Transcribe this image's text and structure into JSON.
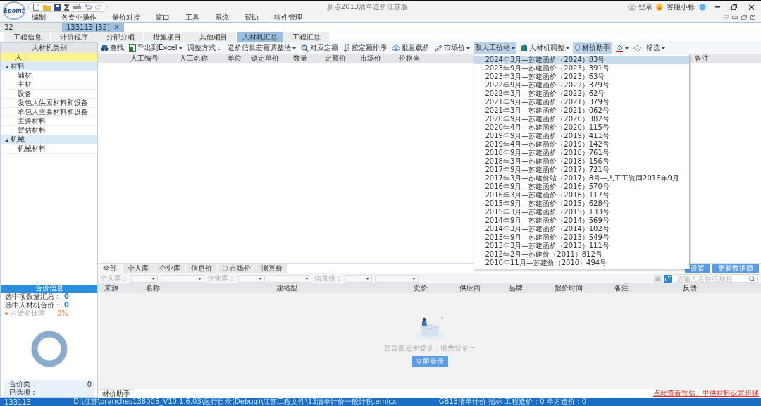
{
  "title_bar": {
    "logo": "Epoint",
    "title": "新点2013清单造价江苏版",
    "login": "登录",
    "service": "客服小栎"
  },
  "menu": [
    "编制",
    "各专业操作",
    "量价对接",
    "窗口",
    "工具",
    "系统",
    "帮助",
    "软件管理"
  ],
  "doc_tabs": [
    {
      "label": "32",
      "selected": false
    },
    {
      "label": "133113 [32]",
      "selected": true,
      "close": "×"
    }
  ],
  "module_tabs": [
    {
      "label": "工程信息",
      "selected": false
    },
    {
      "label": "计价程序",
      "selected": false
    },
    {
      "label": "分部分项",
      "selected": false
    },
    {
      "label": "措施项目",
      "selected": false
    },
    {
      "label": "其他项目",
      "selected": false
    },
    {
      "label": "人材机汇总",
      "selected": true
    },
    {
      "label": "工程汇总",
      "selected": false
    }
  ],
  "category_panel": {
    "title": "人材机类别",
    "items": [
      {
        "label": "人工",
        "selected": true
      },
      {
        "label": "材料",
        "selected": false,
        "expanded": true,
        "children": [
          {
            "label": "辅材",
            "selected": false
          },
          {
            "label": "主材",
            "selected": false
          },
          {
            "label": "设备",
            "selected": false
          },
          {
            "label": "发包人供应材料和设备",
            "selected": false
          },
          {
            "label": "承包人主要材料和设备",
            "selected": false
          },
          {
            "label": "主要材料",
            "selected": false
          },
          {
            "label": "暂估材料",
            "selected": false
          }
        ]
      },
      {
        "label": "机械",
        "selected": false,
        "expanded": true,
        "children": [
          {
            "label": "机械材料",
            "selected": false
          }
        ]
      }
    ]
  },
  "summary": {
    "title": "合价信息",
    "lines": [
      {
        "kind": "count",
        "label": "选中项数量汇总：",
        "value": "0"
      },
      {
        "kind": "count",
        "label": "选中人材机合价：",
        "value": "0"
      },
      {
        "kind": "ratio",
        "label": "占造价比重",
        "value": "0%"
      }
    ],
    "footer": [
      {
        "label": "合价类：",
        "value": "0"
      },
      {
        "label": "已选项："
      }
    ]
  },
  "toolbar": [
    {
      "kind": "button",
      "label": "查找",
      "dropdown": false,
      "active": false
    },
    {
      "kind": "button",
      "label": "导出到Excel",
      "dropdown": true,
      "active": false
    },
    {
      "kind": "label",
      "label": "调整方式："
    },
    {
      "kind": "button",
      "label": "造价信息差额调整法",
      "dropdown": true,
      "active": false
    },
    {
      "kind": "button",
      "label": "对应定额",
      "dropdown": false,
      "active": false
    },
    {
      "kind": "button",
      "label": "按定额排序",
      "dropdown": false,
      "active": false
    },
    {
      "kind": "button",
      "label": "批量载价",
      "dropdown": false,
      "active": false
    },
    {
      "kind": "button",
      "label": "市场价",
      "dropdown": true,
      "active": false
    },
    {
      "kind": "menu",
      "label": "取人工价格",
      "dropdown": true,
      "active": true,
      "expanded": true,
      "menu": [
        {
          "label": "2024年3月—苏建函价（2024）83号",
          "selected": true
        },
        {
          "label": "2023年9月—苏建函价（2023）391号",
          "selected": false
        },
        {
          "label": "2023年3月—苏建函价（2023）63号",
          "selected": false
        },
        {
          "label": "2022年9月—苏建函价（2022）379号",
          "selected": false
        },
        {
          "label": "2022年3月—苏建函价（2022）62号",
          "selected": false
        },
        {
          "label": "2021年9月—苏建函价（2021）379号",
          "selected": false
        },
        {
          "label": "2021年3月—苏建函价（2021）062号",
          "selected": false
        },
        {
          "label": "2020年9月—苏建函价（2020）382号",
          "selected": false
        },
        {
          "label": "2020年4月—苏建函价（2020）115号",
          "selected": false
        },
        {
          "label": "2019年9月—苏建函价（2019）411号",
          "selected": false
        },
        {
          "label": "2019年4月—苏建函价（2019）142号",
          "selected": false
        },
        {
          "label": "2018年9月—苏建函价（2018）761号",
          "selected": false
        },
        {
          "label": "2018年3月—苏建函价（2018）156号",
          "selected": false
        },
        {
          "label": "2017年9月—苏建函价（2017）721号",
          "selected": false
        },
        {
          "label": "2017年3月—苏建价站（2017）8号—人工工资同2016年9月",
          "selected": false
        },
        {
          "label": "2016年9月—苏建函价（2016）570号",
          "selected": false
        },
        {
          "label": "2016年3月—苏建函价（2016）117号",
          "selected": false
        },
        {
          "label": "2015年9月—苏建函价（2015）628号",
          "selected": false
        },
        {
          "label": "2015年3月—苏建函价（2015）133号",
          "selected": false
        },
        {
          "label": "2014年9月—苏建函价（2014）569号",
          "selected": false
        },
        {
          "label": "2014年3月—苏建函价（2014）102号",
          "selected": false
        },
        {
          "label": "2013年9月—苏建函价（2013）549号",
          "selected": false
        },
        {
          "label": "2013年3月—苏建函价（2013）111号",
          "selected": false
        },
        {
          "label": "2012年2月—苏建价（2011）812号",
          "selected": false
        },
        {
          "label": "2010年11月—苏建价（2010）494号",
          "selected": false
        }
      ]
    },
    {
      "kind": "button",
      "label": "人材机调整",
      "dropdown": true,
      "active": false
    },
    {
      "kind": "button",
      "label": "材价助手",
      "dropdown": false,
      "active": true
    },
    {
      "kind": "button",
      "dropdown": true,
      "active": false
    },
    {
      "kind": "button",
      "dropdown": false,
      "active": false
    },
    {
      "kind": "button",
      "label": "筛选",
      "dropdown": true,
      "active": false
    }
  ],
  "main_table": {
    "columns": [
      "人工编号",
      "人工名称",
      "单位",
      "锁定单价",
      "数量",
      "定额价",
      "市场价",
      "价格来",
      "备注"
    ]
  },
  "price_panel": {
    "tabs": [
      {
        "label": "全部",
        "selected": true
      },
      {
        "label": "个人库",
        "selected": false
      },
      {
        "label": "企业库",
        "selected": false
      },
      {
        "label": "信息价",
        "selected": false
      },
      {
        "label": "市场价",
        "selected": false
      },
      {
        "label": "测算价",
        "selected": false
      }
    ],
    "buttons": [
      "设置",
      "更新数据源"
    ],
    "filters": [
      {
        "label": "个人库："
      },
      {
        "label": "企业库："
      },
      {
        "label": "信息价："
      }
    ],
    "search": {
      "placeholder": "请输入名称或规格"
    },
    "columns": [
      "来源",
      "名称",
      "规格型",
      "史价",
      "供应商",
      "品牌",
      "报价时间",
      "备注",
      "反馈"
    ],
    "empty": {
      "message": "您当前还未登录，请先登录~",
      "button": "立即登录"
    },
    "bottom_tab": {
      "label": "材价助手",
      "selected": true
    },
    "link": "点此查看暂估、甲供材料设置步骤"
  },
  "status_bar": [
    "133113",
    "D:\\江苏\\branches138005_V10.1.6.03\\运行目录(Debug)\\江苏工程文件\\13清单计价一般计税.emicx",
    "GB13清单计价 招标 工程造价：0 单方造价：0"
  ]
}
